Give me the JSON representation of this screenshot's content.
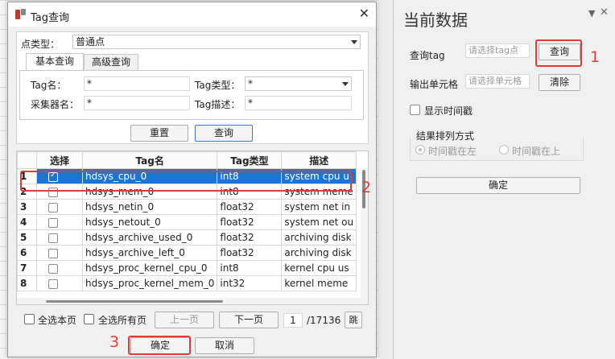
{
  "dialog": {
    "title": "Tag查询",
    "point_type_label": "点类型：",
    "point_type_value": "普通点",
    "tabs": [
      "基本查询",
      "高级查询"
    ],
    "tag_name_label": "Tag名：",
    "tag_name_value": "*",
    "tag_type_label": "Tag类型：",
    "tag_type_value": "*",
    "collector_label": "采集器名：",
    "collector_value": "*",
    "tag_desc_label": "Tag描述：",
    "tag_desc_value": "*",
    "reset_label": "重置",
    "query_label": "查询",
    "columns": [
      "选择",
      "Tag名",
      "Tag类型",
      "描述"
    ],
    "rows": [
      {
        "n": "1",
        "name": "hdsys_cpu_0",
        "type": "int8",
        "desc": "system cpu u",
        "checked": true
      },
      {
        "n": "2",
        "name": "hdsys_mem_0",
        "type": "int8",
        "desc": "system meme",
        "checked": false
      },
      {
        "n": "3",
        "name": "hdsys_netin_0",
        "type": "float32",
        "desc": "system net in",
        "checked": false
      },
      {
        "n": "4",
        "name": "hdsys_netout_0",
        "type": "float32",
        "desc": "system net ou",
        "checked": false
      },
      {
        "n": "5",
        "name": "hdsys_archive_used_0",
        "type": "float32",
        "desc": "archiving disk",
        "checked": false
      },
      {
        "n": "6",
        "name": "hdsys_archive_left_0",
        "type": "float32",
        "desc": "archiving disk",
        "checked": false
      },
      {
        "n": "7",
        "name": "hdsys_proc_kernel_cpu_0",
        "type": "int8",
        "desc": "kernel cpu us",
        "checked": false
      },
      {
        "n": "8",
        "name": "hdsys_proc_kernel_mem_0",
        "type": "int32",
        "desc": "kernel meme",
        "checked": false
      }
    ],
    "select_page_label": "全选本页",
    "select_all_label": "全选所有页",
    "prev_label": "上一页",
    "next_label": "下一页",
    "page_value": "1",
    "page_total": "/17136",
    "jump_label": "跳转",
    "ok_label": "确定",
    "cancel_label": "取消"
  },
  "right_panel": {
    "title": "当前数据",
    "query_tag_label": "查询tag",
    "query_tag_placeholder": "请选择tag点",
    "query_button": "查询",
    "output_cell_label": "输出单元格",
    "output_cell_placeholder": "请选择单元格",
    "clear_button": "清除",
    "show_timestamp_label": "显示时间戳",
    "sort_group_label": "结果排列方式",
    "radio_left_label": "时间戳在左",
    "radio_top_label": "时间戳在上",
    "confirm_button": "确定"
  },
  "annotations": [
    "1",
    "2",
    "3"
  ],
  "colors": {
    "selection": "#1a76d2",
    "annotation": "#e53935"
  }
}
